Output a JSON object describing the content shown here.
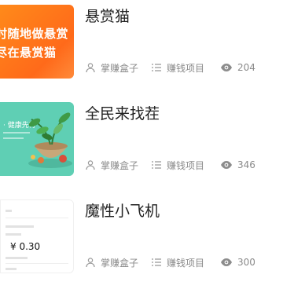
{
  "items": [
    {
      "title": "悬赏猫",
      "author": "掌赚盒子",
      "category": "赚钱项目",
      "views": "204",
      "thumb": {
        "line1": "时随地做悬赏",
        "line2": "尽在悬赏猫"
      }
    },
    {
      "title": "全民来找茬",
      "author": "掌赚盒子",
      "category": "赚钱项目",
      "views": "346",
      "thumb": {
        "headline": "· 健康先行"
      }
    },
    {
      "title": "魔性小飞机",
      "author": "掌赚盒子",
      "category": "赚钱项目",
      "views": "300",
      "thumb": {
        "amount": "¥ 0.30"
      }
    }
  ],
  "colors": {
    "orange": "#ff6a1a",
    "teal": "#5fcfb4",
    "meta_gray": "#8a8a8a"
  },
  "icons": {
    "author": "user-icon",
    "category": "list-icon",
    "views": "eye-icon"
  }
}
